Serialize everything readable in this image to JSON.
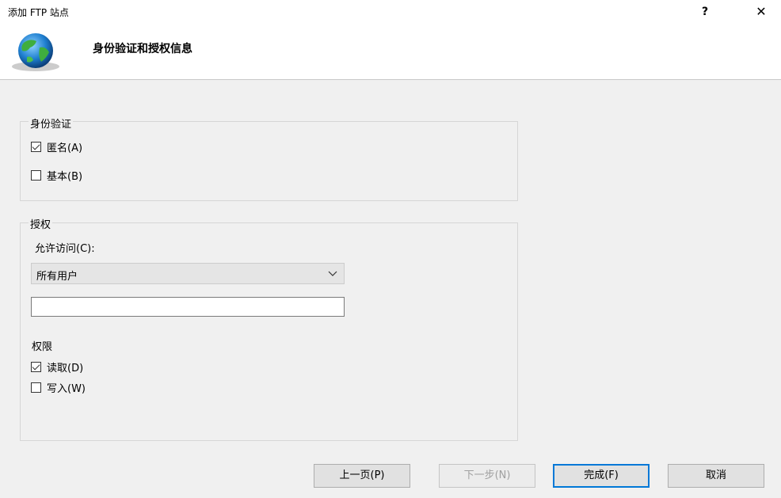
{
  "window": {
    "title": "添加 FTP 站点",
    "help_label": "?",
    "close_label": "✕"
  },
  "header": {
    "title": "身份验证和授权信息"
  },
  "authentication": {
    "group_title": "身份验证",
    "anonymous": {
      "label": "匿名(A)",
      "checked": true
    },
    "basic": {
      "label": "基本(B)",
      "checked": false
    }
  },
  "authorization": {
    "group_title": "授权",
    "allow_access_label": "允许访问(C):",
    "allow_access_selected": "所有用户",
    "user_text_value": "",
    "permissions_label": "权限",
    "read": {
      "label": "读取(D)",
      "checked": true
    },
    "write": {
      "label": "写入(W)",
      "checked": false
    }
  },
  "buttons": {
    "previous": "上一页(P)",
    "next": "下一步(N)",
    "finish": "完成(F)",
    "cancel": "取消"
  },
  "colors": {
    "accent": "#0078d7"
  }
}
